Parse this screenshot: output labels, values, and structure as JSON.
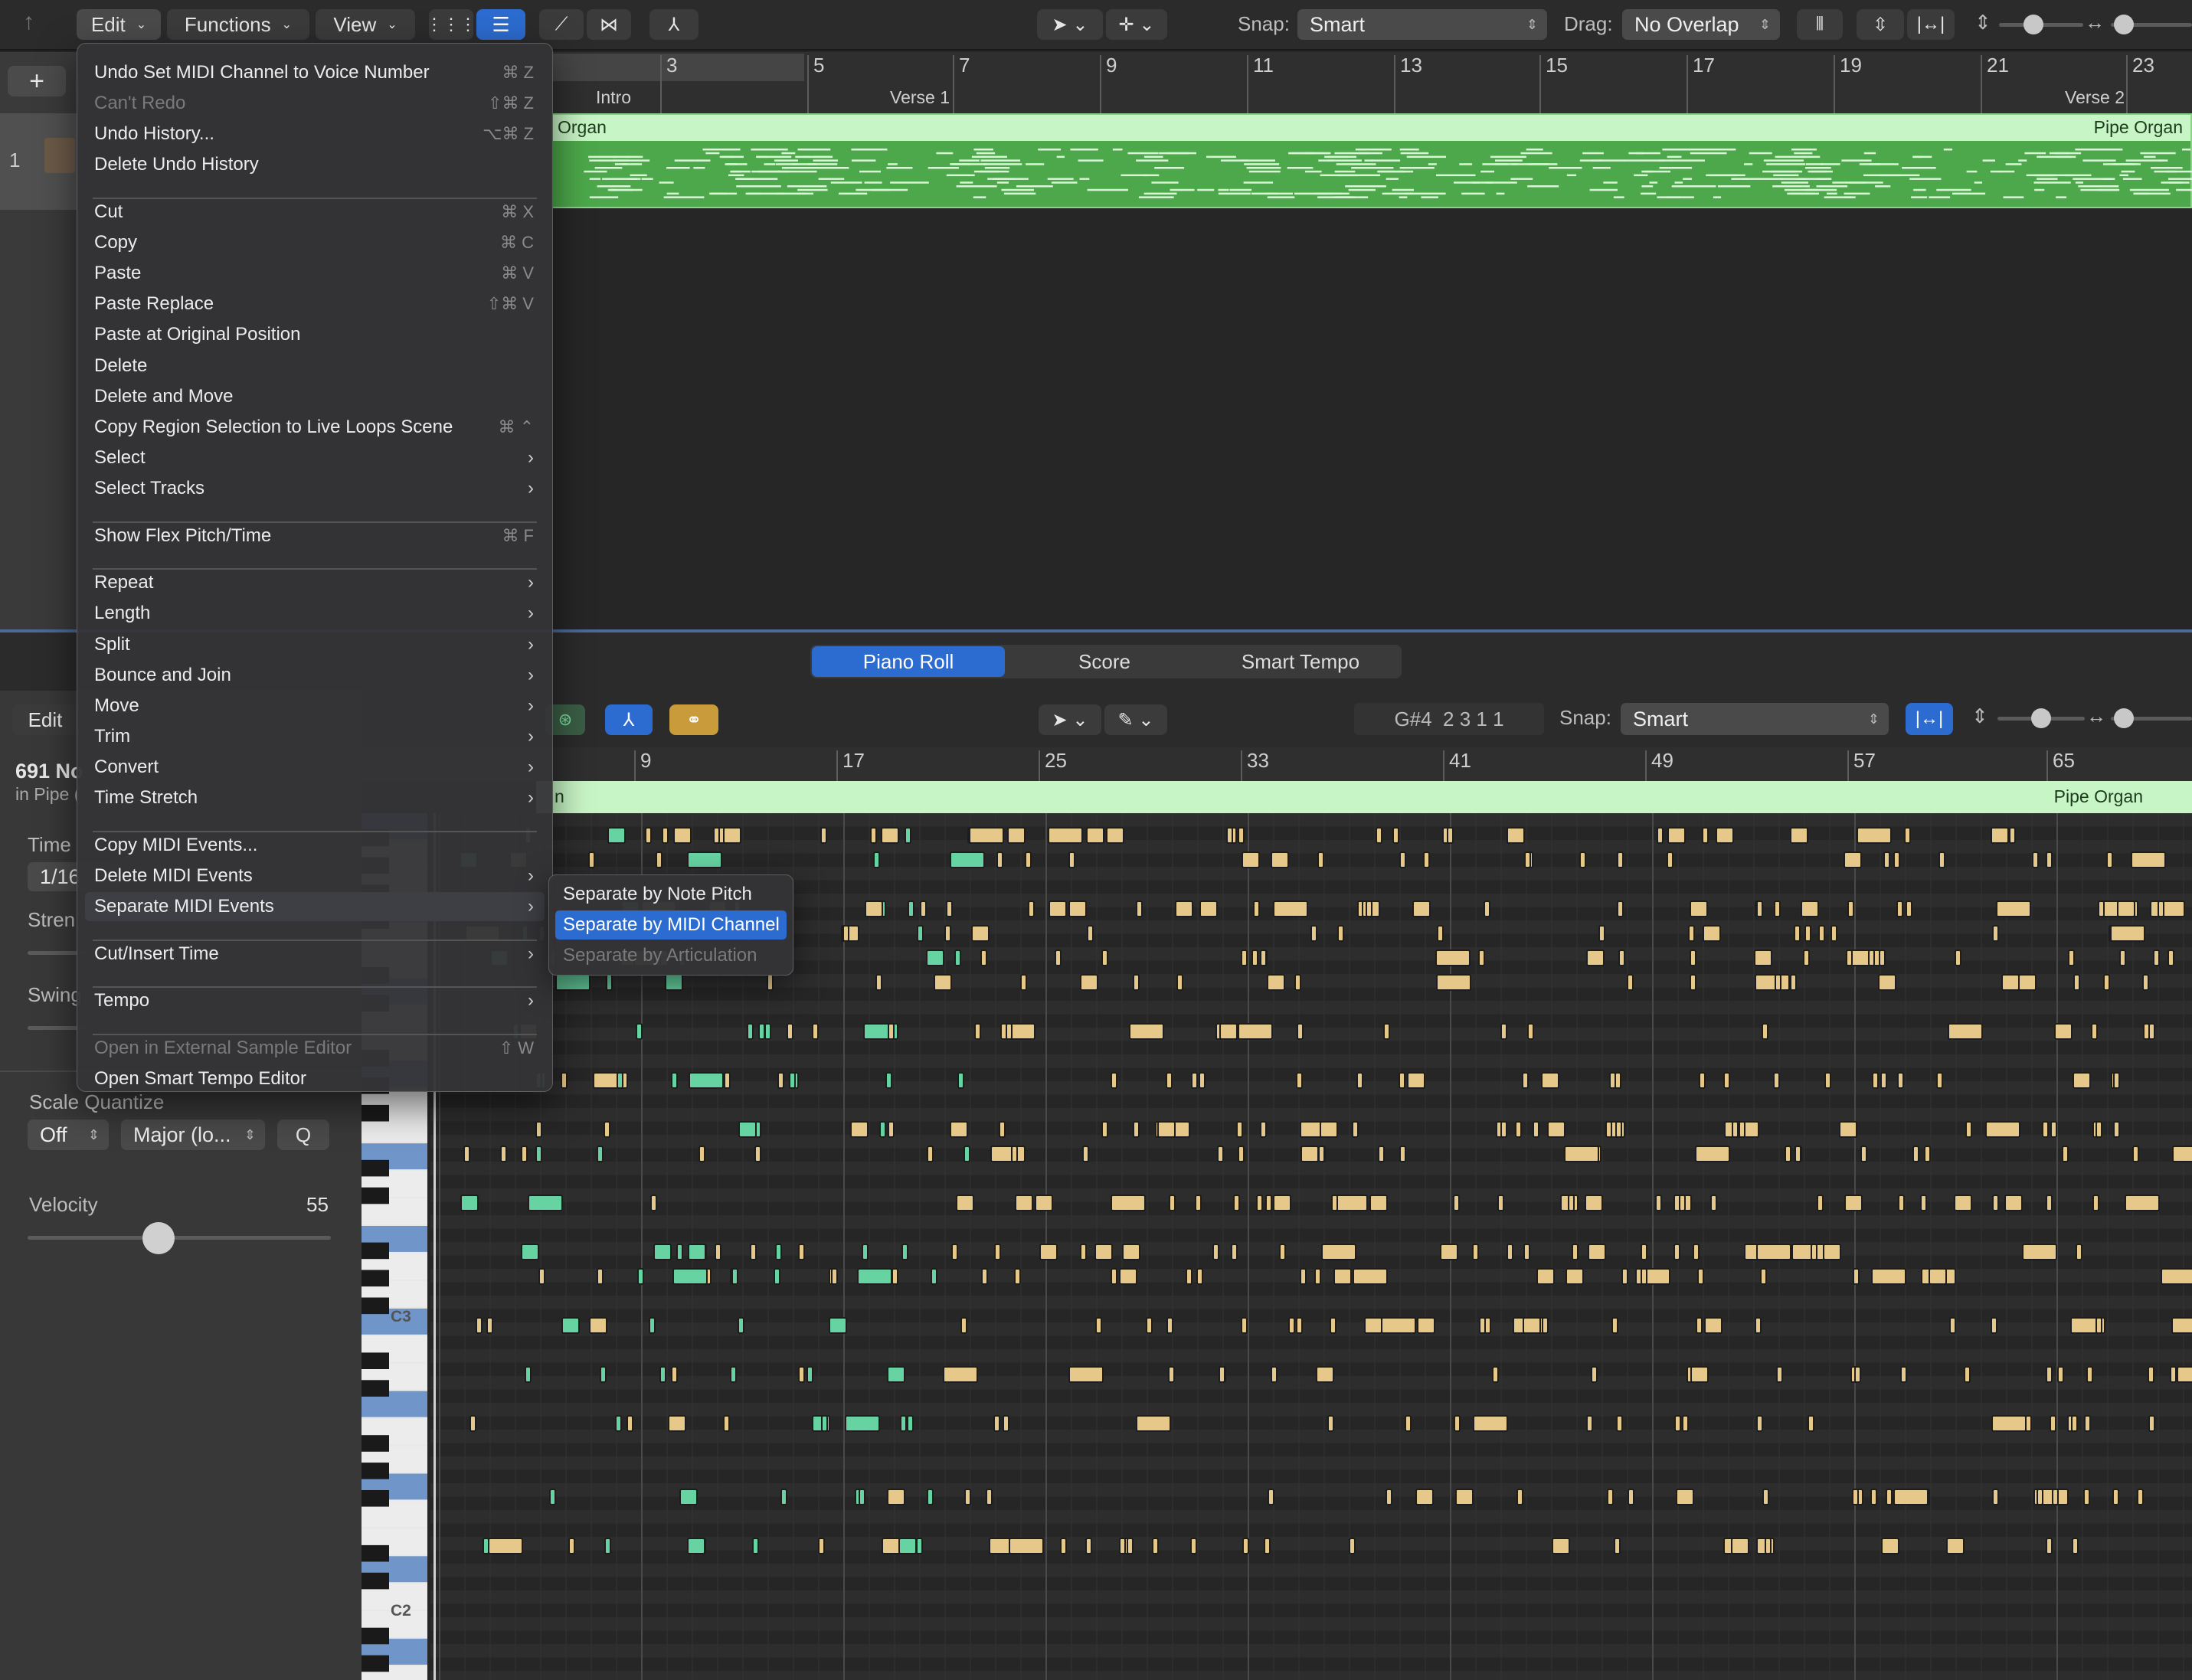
{
  "toolbar": {
    "menus": [
      "Edit",
      "Functions",
      "View"
    ],
    "snap_label": "Snap:",
    "snap_value": "Smart",
    "drag_label": "Drag:",
    "drag_value": "No Overlap"
  },
  "tracks": {
    "add_label": "+",
    "track_number": "1",
    "region_name_left": "Organ",
    "region_name_right": "Pipe Organ",
    "ruler": [
      "3",
      "5",
      "7",
      "9",
      "11",
      "13",
      "15",
      "17",
      "19",
      "21",
      "23"
    ],
    "markers": [
      "Intro",
      "Verse 1",
      "Verse 2"
    ]
  },
  "editor": {
    "tabs": [
      "Piano Roll",
      "Score",
      "Smart Tempo"
    ],
    "active_tab": "Piano Roll",
    "edit_label": "Edit",
    "position_readout": "G#4  2 3 1 1",
    "snap_label": "Snap:",
    "snap_value": "Smart",
    "ruler": [
      "9",
      "17",
      "25",
      "33",
      "41",
      "49",
      "57",
      "65"
    ],
    "region_name_left": "n",
    "region_name_right": "Pipe Organ"
  },
  "inspector": {
    "count_text": "691 No",
    "region_text": "in Pipe (",
    "time_label": "Time",
    "time_value": "1/16",
    "strength_label": "Stren",
    "swing_label": "Swing",
    "scale_quantize_label": "Scale Quantize",
    "scale_off": "Off",
    "scale_type": "Major (lo...",
    "q_label": "Q",
    "velocity_label": "Velocity",
    "velocity_value": "55",
    "key_c3": "C3",
    "key_c2": "C2"
  },
  "edit_menu": {
    "items": [
      {
        "label": "Undo Set MIDI Channel to Voice Number",
        "shortcut": "⌘ Z"
      },
      {
        "label": "Can't Redo",
        "shortcut": "⇧⌘ Z",
        "disabled": true
      },
      {
        "label": "Undo History...",
        "shortcut": "⌥⌘ Z"
      },
      {
        "label": "Delete Undo History"
      },
      {
        "label": "Cut",
        "shortcut": "⌘ X"
      },
      {
        "label": "Copy",
        "shortcut": "⌘ C"
      },
      {
        "label": "Paste",
        "shortcut": "⌘ V"
      },
      {
        "label": "Paste Replace",
        "shortcut": "⇧⌘ V"
      },
      {
        "label": "Paste at Original Position"
      },
      {
        "label": "Delete"
      },
      {
        "label": "Delete and Move"
      },
      {
        "label": "Copy Region Selection to Live Loops Scene",
        "shortcut": "⌘ ⌃"
      },
      {
        "label": "Select",
        "submenu": true
      },
      {
        "label": "Select Tracks",
        "submenu": true
      },
      {
        "label": "Show Flex Pitch/Time",
        "shortcut": "⌘ F"
      },
      {
        "label": "Repeat",
        "submenu": true
      },
      {
        "label": "Length",
        "submenu": true
      },
      {
        "label": "Split",
        "submenu": true
      },
      {
        "label": "Bounce and Join",
        "submenu": true
      },
      {
        "label": "Move",
        "submenu": true
      },
      {
        "label": "Trim",
        "submenu": true
      },
      {
        "label": "Convert",
        "submenu": true
      },
      {
        "label": "Time Stretch",
        "submenu": true
      },
      {
        "label": "Copy MIDI Events..."
      },
      {
        "label": "Delete MIDI Events",
        "submenu": true
      },
      {
        "label": "Separate MIDI Events",
        "submenu": true,
        "highlighted": true
      },
      {
        "label": "Cut/Insert Time",
        "submenu": true
      },
      {
        "label": "Tempo",
        "submenu": true
      },
      {
        "label": "Open in External Sample Editor",
        "shortcut": "⇧ W",
        "disabled": true
      },
      {
        "label": "Open Smart Tempo Editor"
      }
    ],
    "submenu_items": [
      {
        "label": "Separate by Note Pitch"
      },
      {
        "label": "Separate by MIDI Channel",
        "selected": true
      },
      {
        "label": "Separate by Articulation",
        "disabled": true
      }
    ]
  },
  "colors": {
    "accent_blue": "#2c6bcf",
    "region_green": "#4ca84a",
    "region_header": "#c8f5c6",
    "note_yellow": "#e6c98a",
    "note_teal": "#67d3a3"
  }
}
